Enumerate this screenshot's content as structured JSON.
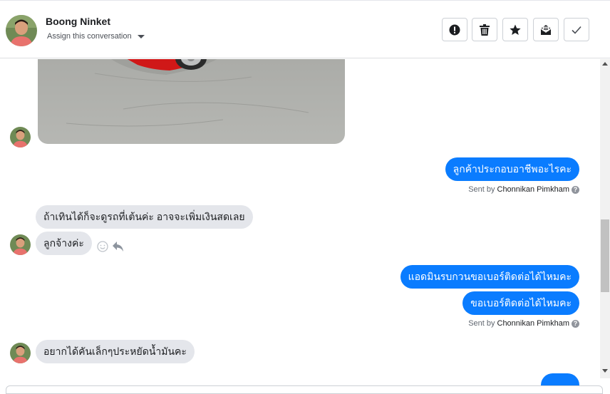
{
  "header": {
    "contact_name": "Boong Ninket",
    "assign_label": "Assign this conversation",
    "actions": [
      {
        "icon": "spam-icon",
        "name": "mark-spam-button"
      },
      {
        "icon": "trash-icon",
        "name": "delete-button"
      },
      {
        "icon": "star-icon",
        "name": "star-button"
      },
      {
        "icon": "mark-unread-icon",
        "name": "mark-unread-button"
      },
      {
        "icon": "check-icon",
        "name": "mark-done-button"
      }
    ]
  },
  "messages": {
    "m1": "ลูกค้าประกอบอาชีพอะไรคะ",
    "m2": "ถ้าเทินได้ก็จะดูรถที่เต้นค่ะ อาจจะเพิ่มเงินสดเลย",
    "m3": "ลูกจ้างค่ะ",
    "m4": "แอดมินรบกวนขอเบอร์ติดต่อได้ไหมคะ",
    "m5": "ขอเบอร์ติดต่อได้ไหมคะ",
    "m6": "อยากได้คันเล็กๆประหยัดน้ำมันคะ"
  },
  "sent_by": {
    "prefix": "Sent by",
    "agent": "Chonnikan Pimkham"
  },
  "colors": {
    "outgoing_bubble": "#0a7cff",
    "incoming_bubble": "#e4e6eb"
  }
}
